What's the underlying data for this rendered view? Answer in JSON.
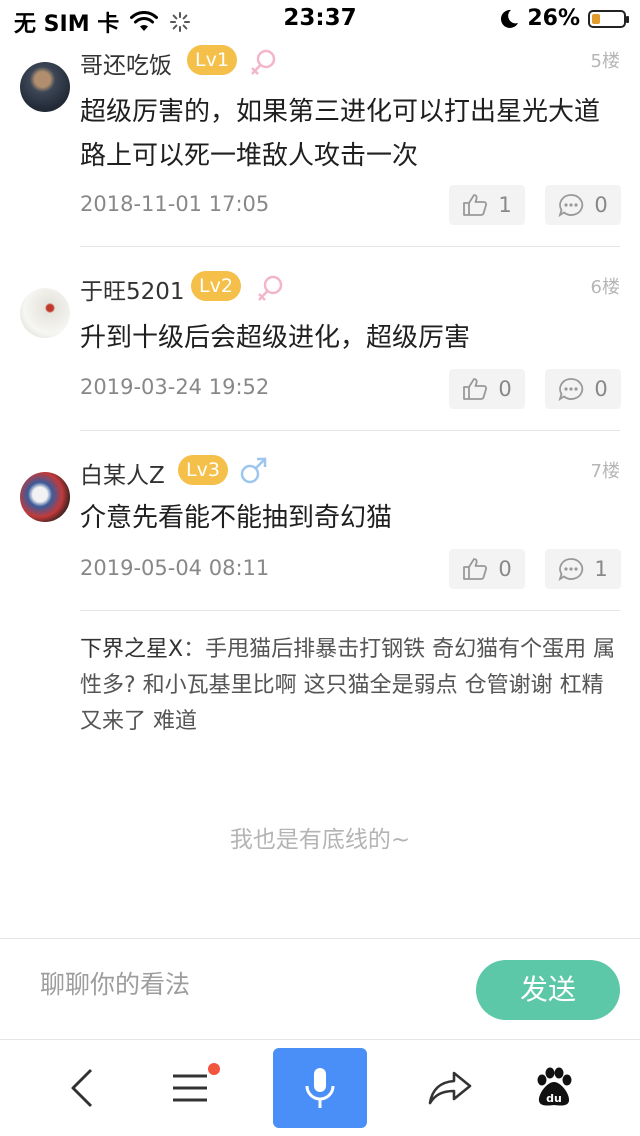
{
  "status_bar": {
    "carrier": "无 SIM 卡",
    "time": "23:37",
    "battery": "26%",
    "battery_level": 0.26
  },
  "comments": [
    {
      "username": "哥还吃饭",
      "level": "Lv1",
      "gender": "female",
      "floor": "5楼",
      "text": "超级厉害的，如果第三进化可以打出星光大道路上可以死一堆敌人攻击一次",
      "date": "2018-11-01 17:05",
      "likes": "1",
      "replies": "0"
    },
    {
      "username": "于旺5201",
      "level": "Lv2",
      "gender": "female",
      "floor": "6楼",
      "text": "升到十级后会超级进化，超级厉害",
      "date": "2019-03-24 19:52",
      "likes": "0",
      "replies": "0"
    },
    {
      "username": "白某人Z",
      "level": "Lv3",
      "gender": "male",
      "floor": "7楼",
      "text": "介意先看能不能抽到奇幻猫",
      "date": "2019-05-04 08:11",
      "likes": "0",
      "replies": "1"
    }
  ],
  "sub_reply": {
    "author": "下界之星X",
    "text": "：手甩猫后排暴击打钢铁 奇幻猫有个蛋用 属性多? 和小瓦基里比啊 这只猫全是弱点 仓管谢谢 杠精又来了 难道"
  },
  "footer_text": "我也是有底线的~",
  "input": {
    "placeholder": "聊聊你的看法",
    "send_label": "发送"
  },
  "bottom_nav": [
    "back-icon",
    "menu-icon",
    "microphone-icon",
    "share-icon",
    "baidu-paw-icon"
  ],
  "colors": {
    "level_badge": "#f5c04a",
    "send_button": "#5dc8a7",
    "mic_button": "#4a8ef7",
    "female": "#f3b6c9",
    "male": "#9cc6ee"
  }
}
